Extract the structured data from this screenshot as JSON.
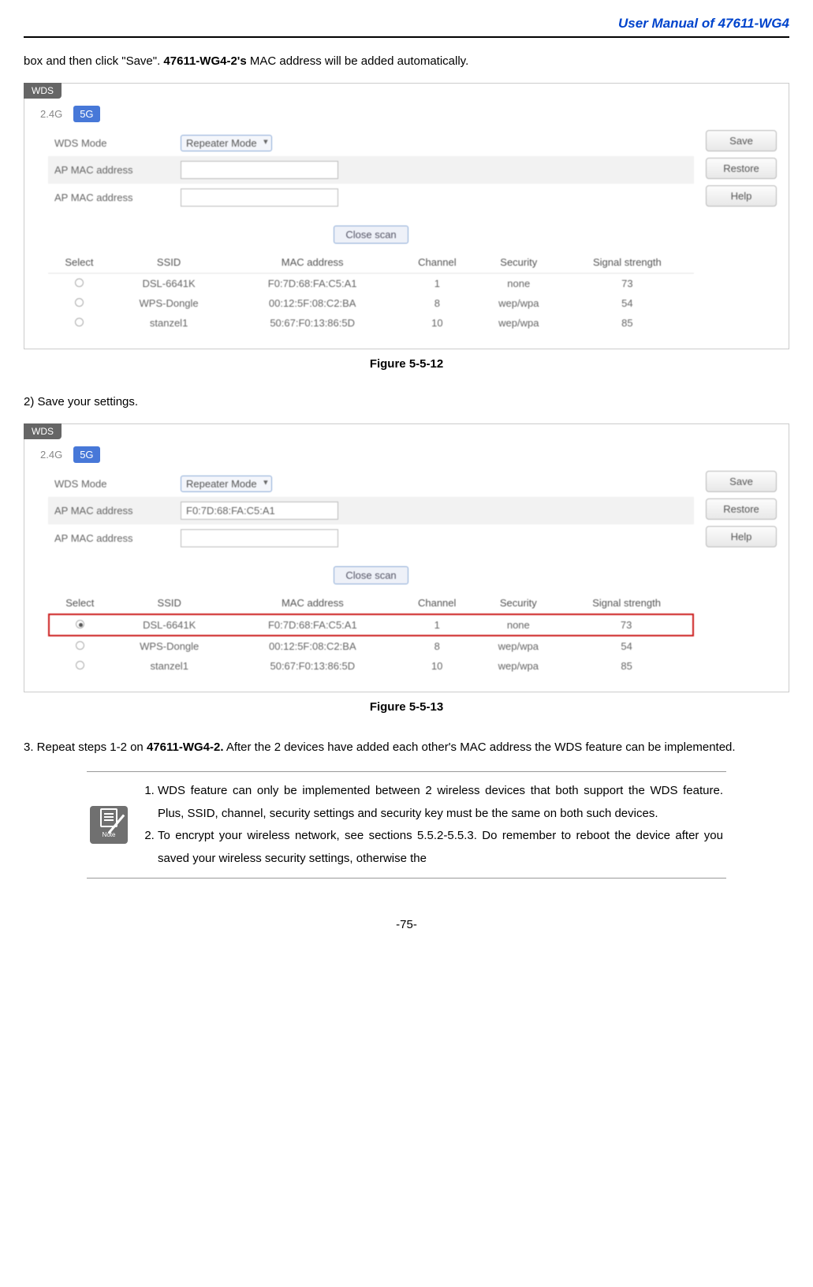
{
  "header_title": "User Manual of 47611-WG4",
  "intro_parts": {
    "prefix": "box and then click \"Save\". ",
    "bold": "47611-WG4-2's",
    "suffix": " MAC address will be added automatically."
  },
  "fig1": {
    "tab_label": "WDS",
    "band_24": "2.4G",
    "band_5": "5G",
    "rows": {
      "wds_mode_label": "WDS Mode",
      "wds_mode_value": "Repeater Mode",
      "mac1_label": "AP MAC address",
      "mac1_value": "",
      "mac2_label": "AP MAC address",
      "mac2_value": ""
    },
    "scan_btn": "Close scan",
    "table_headers": {
      "select": "Select",
      "ssid": "SSID",
      "mac": "MAC address",
      "channel": "Channel",
      "security": "Security",
      "signal": "Signal strength"
    },
    "table_rows": [
      {
        "ssid": "DSL-6641K",
        "mac": "F0:7D:68:FA:C5:A1",
        "ch": "1",
        "sec": "none",
        "sig": "73",
        "checked": false
      },
      {
        "ssid": "WPS-Dongle",
        "mac": "00:12:5F:08:C2:BA",
        "ch": "8",
        "sec": "wep/wpa",
        "sig": "54",
        "checked": false
      },
      {
        "ssid": "stanzel1",
        "mac": "50:67:F0:13:86:5D",
        "ch": "10",
        "sec": "wep/wpa",
        "sig": "85",
        "checked": false
      }
    ],
    "buttons": {
      "save": "Save",
      "restore": "Restore",
      "help": "Help"
    },
    "caption": "Figure 5-5-12"
  },
  "step2_text": "2) Save your settings.",
  "fig2": {
    "tab_label": "WDS",
    "band_24": "2.4G",
    "band_5": "5G",
    "rows": {
      "wds_mode_label": "WDS Mode",
      "wds_mode_value": "Repeater Mode",
      "mac1_label": "AP MAC address",
      "mac1_value": "F0:7D:68:FA:C5:A1",
      "mac2_label": "AP MAC address",
      "mac2_value": ""
    },
    "scan_btn": "Close scan",
    "table_headers": {
      "select": "Select",
      "ssid": "SSID",
      "mac": "MAC address",
      "channel": "Channel",
      "security": "Security",
      "signal": "Signal strength"
    },
    "table_rows": [
      {
        "ssid": "DSL-6641K",
        "mac": "F0:7D:68:FA:C5:A1",
        "ch": "1",
        "sec": "none",
        "sig": "73",
        "checked": true,
        "highlight": true
      },
      {
        "ssid": "WPS-Dongle",
        "mac": "00:12:5F:08:C2:BA",
        "ch": "8",
        "sec": "wep/wpa",
        "sig": "54",
        "checked": false
      },
      {
        "ssid": "stanzel1",
        "mac": "50:67:F0:13:86:5D",
        "ch": "10",
        "sec": "wep/wpa",
        "sig": "85",
        "checked": false
      }
    ],
    "buttons": {
      "save": "Save",
      "restore": "Restore",
      "help": "Help"
    },
    "caption": "Figure 5-5-13"
  },
  "step3_parts": {
    "p1": "3. Repeat steps 1-2 on ",
    "bold1": "47611-WG4-2.",
    "p2": " After the 2 devices have added each other's MAC address the WDS feature can be implemented."
  },
  "note": {
    "icon_label": "Note",
    "item1": "WDS feature can only be implemented between 2 wireless devices that both support the WDS feature. Plus, SSID, channel, security settings and security key must be the same on both such devices.",
    "item2_parts": {
      "p1": "To encrypt your wireless network, see ",
      "bold": "sections 5.5.2-5.5.3",
      "p2": ". Do remember to reboot the device after you saved your wireless security settings, otherwise the"
    }
  },
  "page_number": "-75-"
}
